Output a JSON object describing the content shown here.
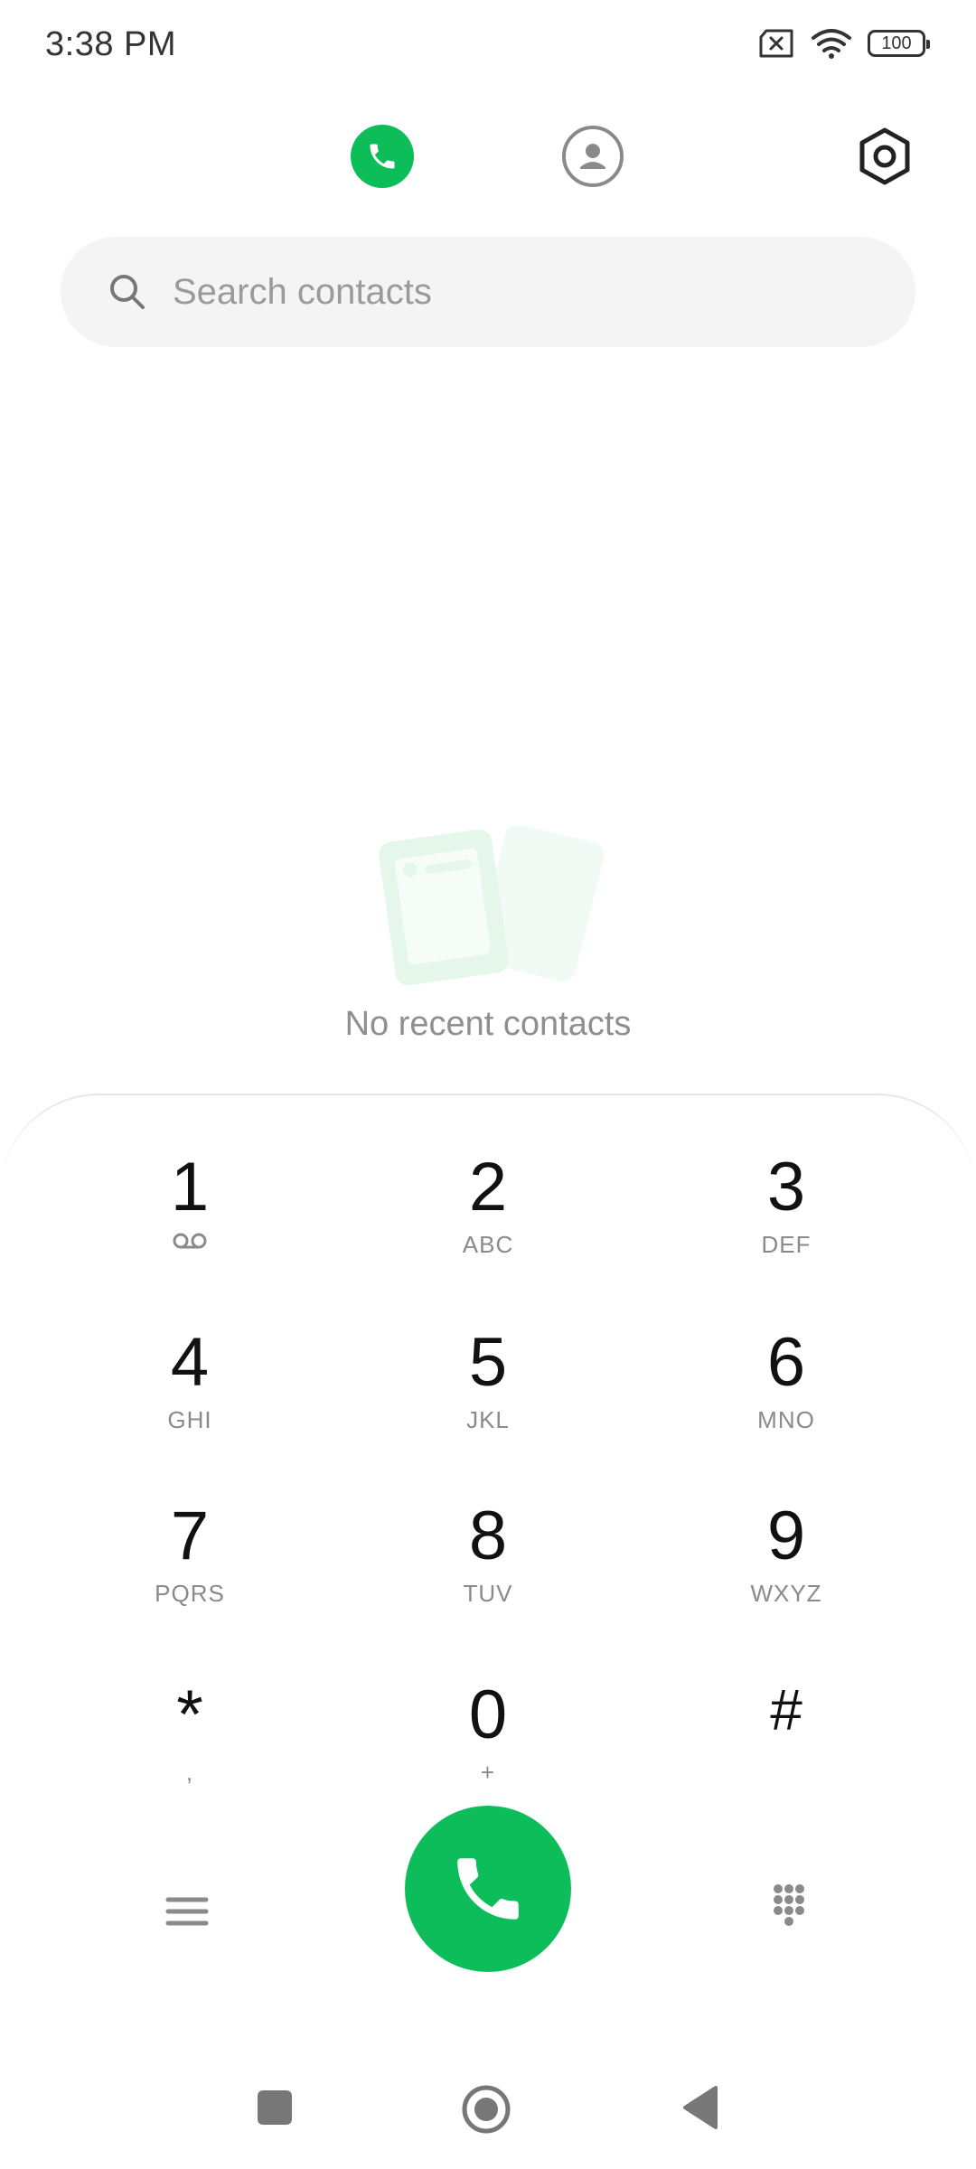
{
  "status_bar": {
    "time": "3:38 PM",
    "battery": "100"
  },
  "search": {
    "placeholder": "Search contacts",
    "value": ""
  },
  "empty_state": {
    "message": "No recent contacts"
  },
  "keypad": [
    {
      "digit": "1",
      "letters": ""
    },
    {
      "digit": "2",
      "letters": "ABC"
    },
    {
      "digit": "3",
      "letters": "DEF"
    },
    {
      "digit": "4",
      "letters": "GHI"
    },
    {
      "digit": "5",
      "letters": "JKL"
    },
    {
      "digit": "6",
      "letters": "MNO"
    },
    {
      "digit": "7",
      "letters": "PQRS"
    },
    {
      "digit": "8",
      "letters": "TUV"
    },
    {
      "digit": "9",
      "letters": "WXYZ"
    },
    {
      "digit": "*",
      "letters": ","
    },
    {
      "digit": "0",
      "letters": "+"
    },
    {
      "digit": "#",
      "letters": ""
    }
  ],
  "icons": {
    "tab_dialer": "phone-icon",
    "tab_contacts": "contacts-icon",
    "settings": "gear-icon",
    "voicemail": "voicemail-icon",
    "call": "phone-icon",
    "menu": "menu-icon",
    "dialpad": "dialpad-icon"
  },
  "colors": {
    "accent": "#0dbd5a",
    "search_bg": "#f4f4f4",
    "muted_text": "#8f8f8f"
  }
}
